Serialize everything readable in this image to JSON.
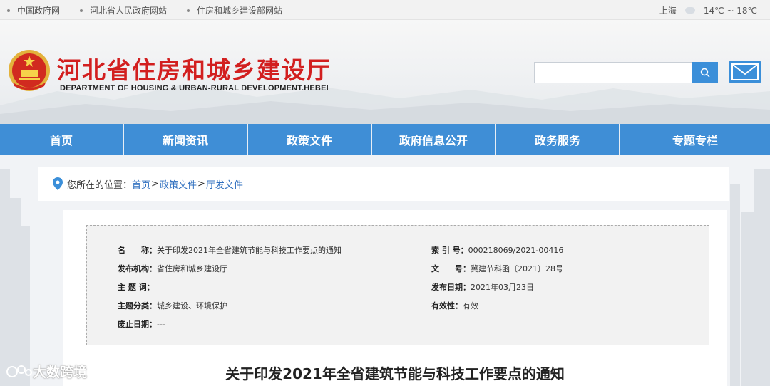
{
  "topbar": {
    "links": [
      "中国政府网",
      "河北省人民政府网站",
      "住房和城乡建设部网站"
    ],
    "city": "上海",
    "temperature": "14℃ ~ 18℃"
  },
  "header": {
    "title": "河北省住房和城乡建设厅",
    "subtitle": "DEPARTMENT OF HOUSING & URBAN-RURAL DEVELOPMENT.HEBEI",
    "search": {
      "placeholder": "",
      "value": ""
    }
  },
  "colors": {
    "brand_red": "#d21f1f",
    "nav_blue": "#3f8ed6",
    "link_blue": "#2f6fbf"
  },
  "nav": [
    "首页",
    "新闻资讯",
    "政策文件",
    "政府信息公开",
    "政务服务",
    "专题专栏"
  ],
  "breadcrumb": {
    "label": "您所在的位置：",
    "items": [
      "首页",
      "政策文件",
      "厅发文件"
    ],
    "separator": ">"
  },
  "meta": {
    "name_k": "名　　称：",
    "name_v": "关于印发2021年全省建筑节能与科技工作要点的通知",
    "index_k": "索 引 号：",
    "index_v": "000218069/2021-00416",
    "org_k": "发布机构：",
    "org_v": "省住房和城乡建设厅",
    "docno_k": "文　　号：",
    "docno_v": "冀建节科函〔2021〕28号",
    "topic_k": "主 题 词：",
    "topic_v": "",
    "date_k": "发布日期：",
    "date_v": "2021年03月23日",
    "cat_k": "主题分类：",
    "cat_v": "城乡建设、环境保护",
    "valid_k": "有效性：",
    "valid_v": "有效",
    "expire_k": "废止日期：",
    "expire_v": "---"
  },
  "document": {
    "title": "关于印发2021年全省建筑节能与科技工作要点的通知"
  },
  "watermark": {
    "text": "大数跨境"
  },
  "icons": [
    "emblem-icon",
    "search-icon",
    "mail-icon",
    "location-pin-icon",
    "cloud-icon"
  ]
}
